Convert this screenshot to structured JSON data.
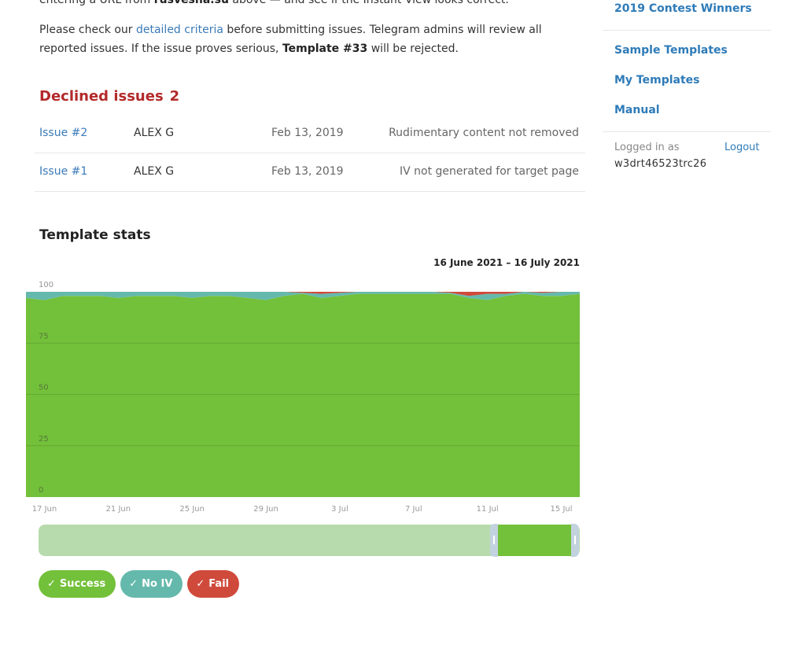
{
  "intro": {
    "line1_a": "entering a URL from ",
    "line1_domain": "rusvesna.su",
    "line1_b": " above — and see if the Instant View looks correct.",
    "p2_a": "Please check our ",
    "p2_link": "detailed criteria",
    "p2_b": " before submitting issues. Telegram admins will review all reported issues. If the issue proves serious, ",
    "p2_template": "Template #33",
    "p2_c": " will be rejected."
  },
  "declined": {
    "title": "Declined issues",
    "count": "2",
    "issues": [
      {
        "id": "Issue #2",
        "author": "ALEX G",
        "date": "Feb 13, 2019",
        "reason": "Rudimentary content not removed"
      },
      {
        "id": "Issue #1",
        "author": "ALEX G",
        "date": "Feb 13, 2019",
        "reason": "IV not generated for target page"
      }
    ]
  },
  "stats": {
    "title": "Template stats",
    "range": "16 June 2021 – 16 July 2021"
  },
  "legend": {
    "success": "Success",
    "noiv": "No IV",
    "fail": "Fail"
  },
  "navigator": {
    "window_start": 0.835,
    "window_end": 0.985
  },
  "sidebar": {
    "links": [
      {
        "label": "2019 Contest Winners"
      },
      {
        "label": "Sample Templates"
      },
      {
        "label": "My Templates"
      },
      {
        "label": "Manual"
      }
    ],
    "logged_in_label": "Logged in as",
    "logout_label": "Logout",
    "username": "w3drt46523trc26"
  },
  "colors": {
    "success": "#73c03a",
    "noiv": "#65b9ac",
    "fail": "#cf4a3b",
    "link": "#3a7ab8",
    "declined": "#b32a2a"
  },
  "chart_data": {
    "type": "area",
    "stacking": "percent",
    "x": [
      "16 Jun",
      "17 Jun",
      "18 Jun",
      "19 Jun",
      "20 Jun",
      "21 Jun",
      "22 Jun",
      "23 Jun",
      "24 Jun",
      "25 Jun",
      "26 Jun",
      "27 Jun",
      "28 Jun",
      "29 Jun",
      "30 Jun",
      "1 Jul",
      "2 Jul",
      "3 Jul",
      "4 Jul",
      "5 Jul",
      "6 Jul",
      "7 Jul",
      "8 Jul",
      "9 Jul",
      "10 Jul",
      "11 Jul",
      "12 Jul",
      "13 Jul",
      "14 Jul",
      "15 Jul",
      "16 Jul"
    ],
    "xticks": [
      "17 Jun",
      "21 Jun",
      "25 Jun",
      "29 Jun",
      "3 Jul",
      "7 Jul",
      "11 Jul",
      "15 Jul"
    ],
    "yticks": [
      "0",
      "25",
      "50",
      "75",
      "100"
    ],
    "ylim": [
      0,
      100
    ],
    "grid": true,
    "series": [
      {
        "name": "Success",
        "color": "#73c03a",
        "values": [
          97,
          96,
          98,
          98,
          98,
          97,
          98,
          98,
          98,
          97,
          98,
          98,
          97,
          96,
          98,
          99,
          97,
          98,
          99,
          99,
          99,
          99,
          99,
          99,
          97,
          96,
          98,
          99,
          98,
          98,
          99
        ]
      },
      {
        "name": "No IV",
        "color": "#65b9ac",
        "values": [
          3,
          4,
          2,
          2,
          2,
          3,
          2,
          2,
          2,
          3,
          2,
          2,
          3,
          4,
          2,
          0.5,
          2,
          1.5,
          1,
          1,
          1,
          1,
          1,
          0.5,
          1,
          3,
          1,
          1,
          1.5,
          2,
          1
        ]
      },
      {
        "name": "Fail",
        "color": "#cf4a3b",
        "values": [
          0,
          0,
          0,
          0,
          0,
          0,
          0,
          0,
          0,
          0,
          0,
          0,
          0,
          0,
          0,
          0.5,
          1,
          0.5,
          0,
          0,
          0,
          0,
          0,
          0.5,
          2,
          1,
          1,
          0,
          0.5,
          0,
          0
        ]
      }
    ]
  }
}
